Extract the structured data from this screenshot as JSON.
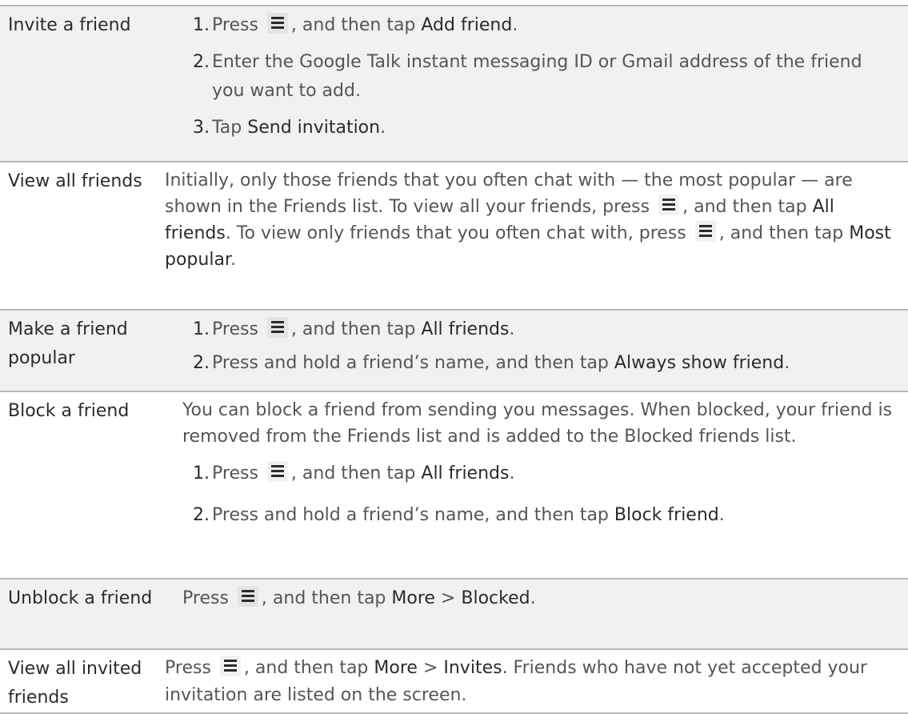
{
  "rows": [
    {
      "label": "Invite a friend",
      "steps": [
        {
          "num": "1.",
          "a": "Press",
          "b": ", and then tap",
          "c": "Add friend",
          "d": "."
        },
        {
          "num": "2.",
          "text": "Enter the Google Talk instant messaging ID or Gmail address of the friend you want to add."
        },
        {
          "num": "3.",
          "a": "Tap",
          "c": "Send invitation",
          "d": "."
        }
      ]
    },
    {
      "label": "View all friends",
      "p1": "Initially, only those friends that you often chat with — the most popular — are shown in the Friends list. To view all your friends, press",
      "p2": ", and then tap",
      "ui1": "All friends",
      "p3": ". To view only friends that you often chat with, press",
      "p4": ", and then tap",
      "ui2": "Most popular",
      "p5": "."
    },
    {
      "label": "Make a friend popular",
      "steps": [
        {
          "num": "1.",
          "a": "Press",
          "b": ", and then tap",
          "c": "All friends",
          "d": "."
        },
        {
          "num": "2.",
          "a": "Press and hold a friend’s name, and then tap",
          "c": "Always show friend",
          "d": "."
        }
      ]
    },
    {
      "label": "Block a friend",
      "intro": "You can block a friend from sending you messages. When blocked, your friend is removed from the Friends list and is added to the Blocked friends list.",
      "steps": [
        {
          "num": "1.",
          "a": "Press",
          "b": ", and then tap",
          "c": "All friends",
          "d": "."
        },
        {
          "num": "2.",
          "a": "Press and hold a friend’s name, and then tap",
          "c": "Block friend",
          "d": "."
        }
      ]
    },
    {
      "label": "Unblock a friend",
      "a": "Press",
      "b": ", and then tap",
      "ui1": "More",
      "sep": ">",
      "ui2": "Blocked",
      "d": "."
    },
    {
      "label": "View all invited friends",
      "a": "Press",
      "b": ", and then tap",
      "ui1": "More",
      "sep": ">",
      "ui2": "Invites",
      "rest": ". Friends who have not yet accepted your invitation are listed on the screen."
    }
  ],
  "menu_icon": "menu-icon"
}
